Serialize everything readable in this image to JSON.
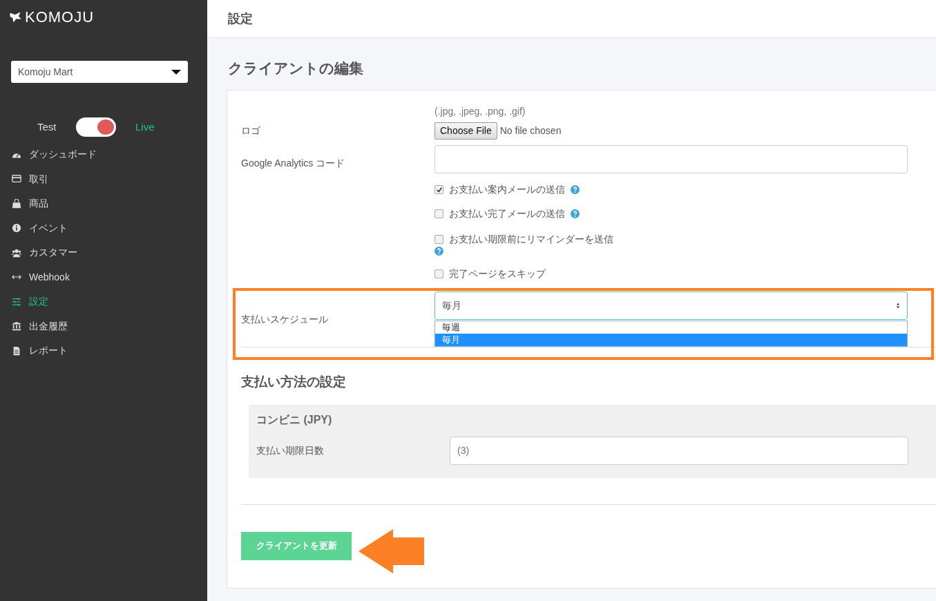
{
  "sidebar": {
    "brand": "KOMOJU",
    "account_select": {
      "value": "Komoju Mart"
    },
    "mode_toggle": {
      "left_label": "Test",
      "right_label": "Live",
      "on": true
    },
    "items": [
      {
        "label": "ダッシュボード",
        "kind": "gauge",
        "selected": false
      },
      {
        "label": "取引",
        "kind": "card",
        "selected": false
      },
      {
        "label": "商品",
        "kind": "bag",
        "selected": false
      },
      {
        "label": "イベント",
        "kind": "info",
        "selected": false
      },
      {
        "label": "カスタマー",
        "kind": "users",
        "selected": false
      },
      {
        "label": "Webhook",
        "kind": "arrows",
        "selected": false
      },
      {
        "label": "設定",
        "kind": "sliders",
        "selected": true
      },
      {
        "label": "出金履歴",
        "kind": "bank",
        "selected": false
      },
      {
        "label": "レポート",
        "kind": "file",
        "selected": false
      }
    ]
  },
  "header": {
    "title": "設定"
  },
  "page_title": "クライアントの編集",
  "form": {
    "logo": {
      "hint": "(.jpg, .jpeg, .png, .gif)",
      "label": "ロゴ",
      "button": "Choose File",
      "file_status": "No file chosen"
    },
    "analytics": {
      "label": "Google Analytics コード"
    },
    "checkboxes": [
      {
        "label": "お支払い案内メールの送信",
        "checked": true,
        "help": true
      },
      {
        "label": "お支払い完了メールの送信",
        "checked": false,
        "help": true
      },
      {
        "label": "お支払い期限前にリマインダーを送信",
        "checked": false,
        "help": true,
        "help_wrapped": true
      },
      {
        "label": "完了ページをスキップ",
        "checked": false,
        "help": false
      }
    ],
    "schedule": {
      "label": "支払いスケジュール",
      "value": "毎月",
      "expanded": true,
      "options": [
        {
          "label": "毎週",
          "selected": false
        },
        {
          "label": "毎月",
          "selected": true
        }
      ]
    }
  },
  "payment_section": {
    "title": "支払い方法の設定",
    "methods": [
      {
        "title": "コンビニ (JPY)",
        "field_label": "支払い期限日数",
        "placeholder": "(3)"
      }
    ]
  },
  "submit_button": "クライアントを更新",
  "annotations": {
    "highlight_frame": true,
    "arrow": true
  }
}
